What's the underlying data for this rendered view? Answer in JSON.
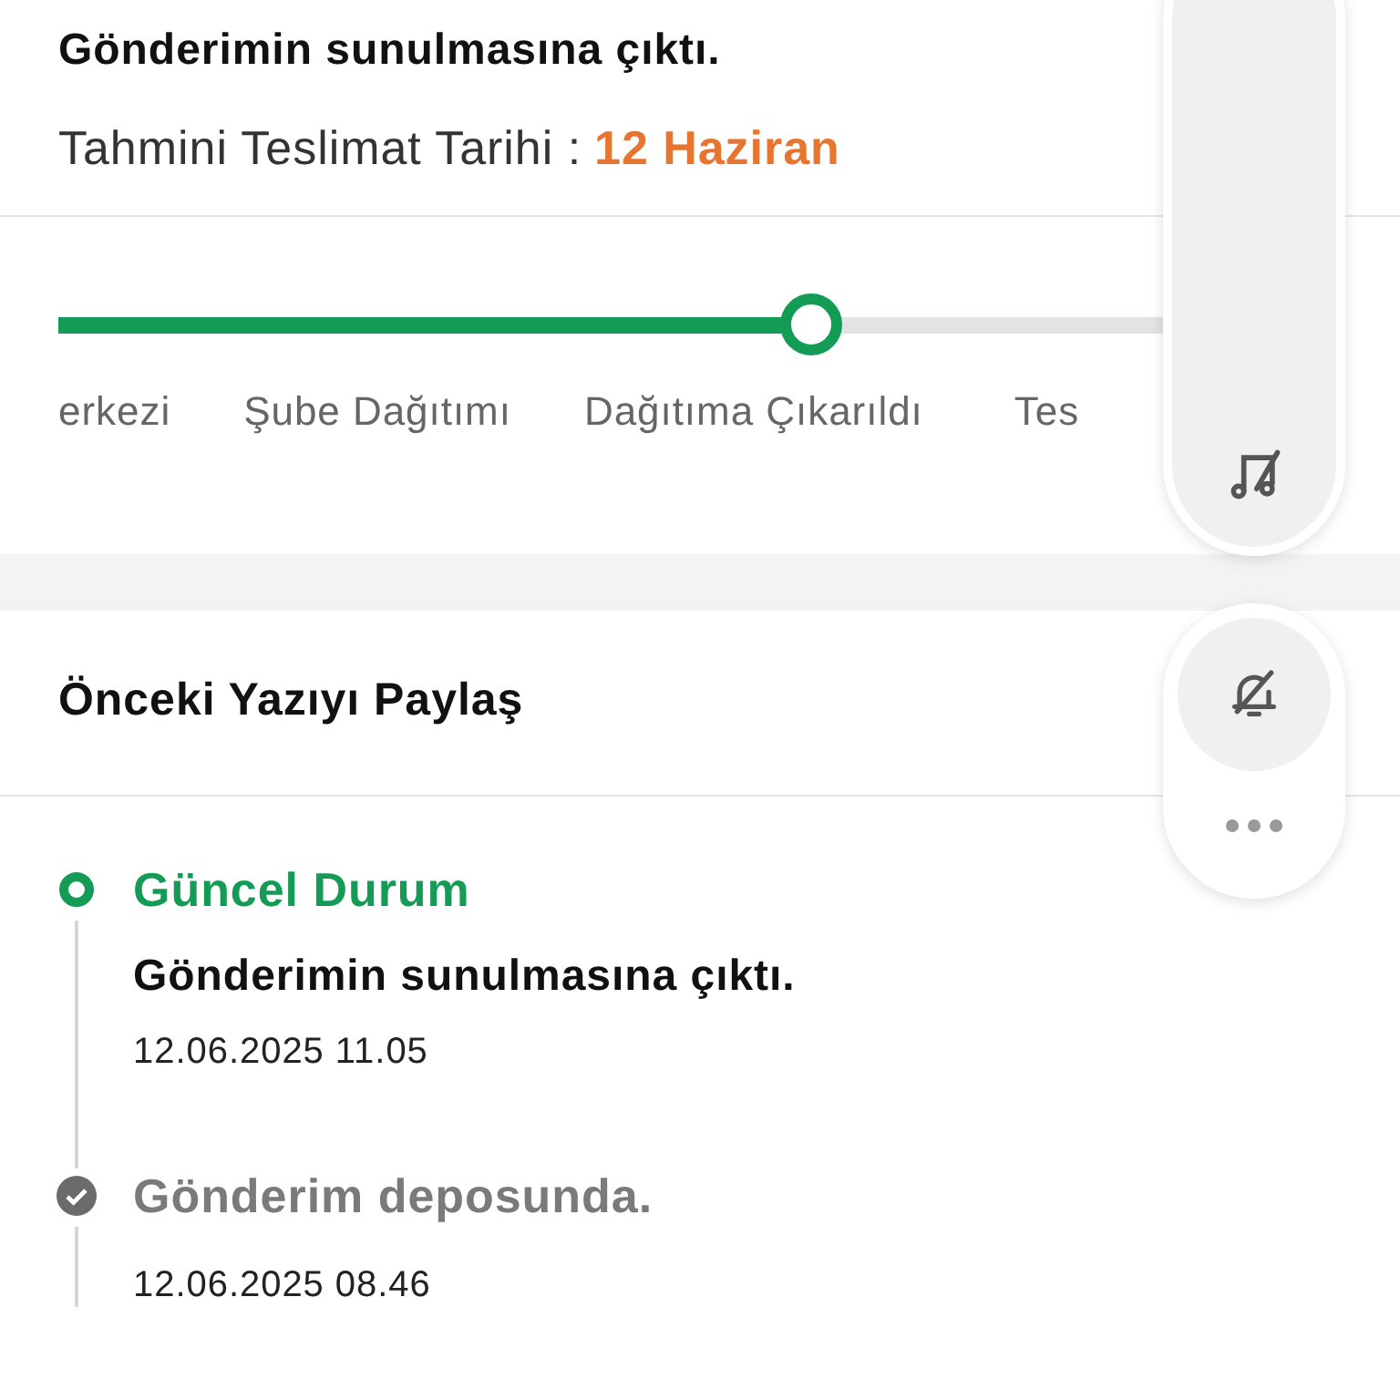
{
  "status": {
    "title": "Gönderimin sunulmasına çıktı.",
    "estimate_label": "Tahmini Teslimat Tarihi :",
    "estimate_value": "12 Haziran"
  },
  "progress": {
    "level": 0.68,
    "steps": [
      "erkezi",
      "Şube Dağıtımı",
      "Dağıtıma Çıkarıldı",
      "Tes"
    ]
  },
  "share": {
    "title": "Önceki Yazıyı Paylaş"
  },
  "timeline": [
    {
      "kind": "current",
      "title": "Güncel Durum",
      "message": "Gönderimin sunulmasına çıktı.",
      "date": "12.06.2025 11.05"
    },
    {
      "kind": "done",
      "title": "Gönderim deposunda.",
      "date": "12.06.2025 08.46"
    }
  ]
}
